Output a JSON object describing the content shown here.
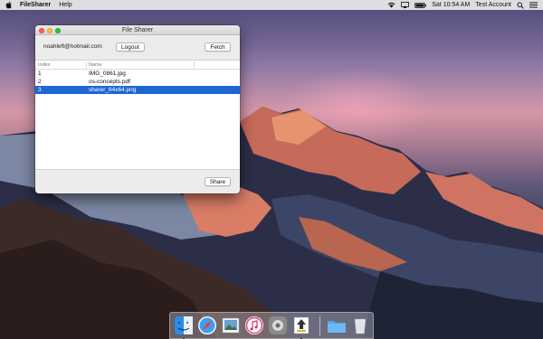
{
  "menubar": {
    "app_name": "FileSharer",
    "menus": [
      "Help"
    ],
    "clock": "Sat 10:54 AM",
    "user": "Test Account",
    "status_icons": [
      "wifi-icon",
      "airplay-icon",
      "battery-icon"
    ],
    "right_icons": [
      "search-icon",
      "list-icon"
    ]
  },
  "window": {
    "title": "File Sharer",
    "email": "noahleft@hotmail.com",
    "logout_label": "Logout",
    "fetch_label": "Fetch",
    "share_label": "Share",
    "table": {
      "headers": [
        "Index",
        "Name"
      ],
      "rows": [
        {
          "index": "1",
          "name": "IMG_0861.jpg"
        },
        {
          "index": "2",
          "name": "os-concepts.pdf"
        },
        {
          "index": "3",
          "name": "sharer_64x64.png"
        }
      ],
      "selected_index": 3
    }
  },
  "dock": {
    "apps": [
      "finder-icon",
      "safari-icon",
      "preview-icon",
      "itunes-icon",
      "system-preferences-icon",
      "filesharer-app-icon"
    ],
    "extras": [
      "downloads-folder-icon",
      "trash-icon"
    ]
  },
  "colors": {
    "selection": "#1f66d3",
    "close": "#fc5f57",
    "minimize": "#fdbc2e",
    "maximize": "#28c840"
  }
}
